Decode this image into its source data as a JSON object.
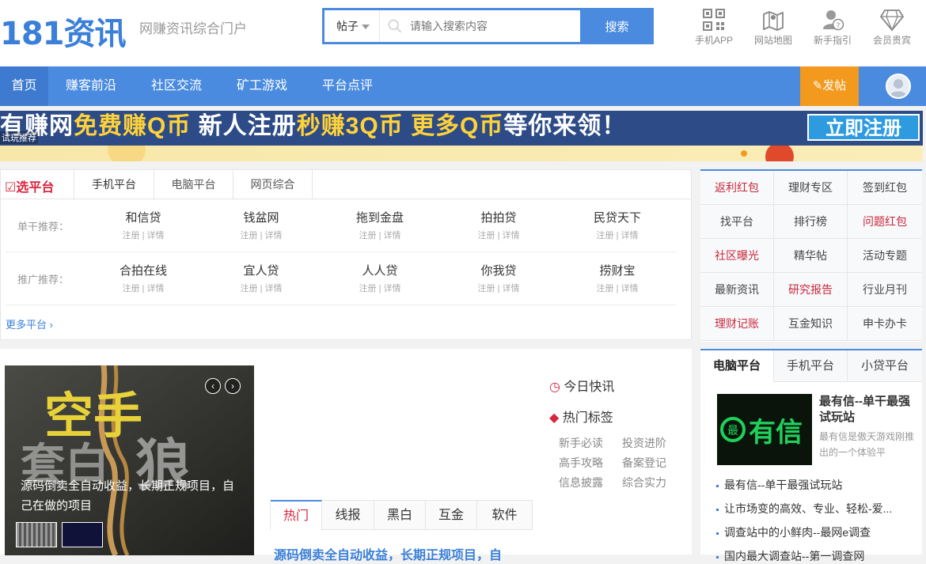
{
  "header": {
    "logo_text": "181资讯",
    "slogan": "网赚资讯综合门户",
    "search": {
      "category": "帖子",
      "placeholder": "请输入搜索内容",
      "button_label": "搜索"
    },
    "quick_links": [
      {
        "label": "手机APP",
        "icon": "qrcode-icon"
      },
      {
        "label": "网站地图",
        "icon": "map-icon"
      },
      {
        "label": "新手指引",
        "icon": "help-user-icon"
      },
      {
        "label": "会员贵宾",
        "icon": "diamond-icon"
      }
    ]
  },
  "nav": {
    "items": [
      "首页",
      "赚客前沿",
      "社区交流",
      "矿工游戏",
      "平台点评"
    ],
    "active_index": 0,
    "post_button": "发帖"
  },
  "banner": {
    "text_parts": [
      "有赚网",
      "免费赚Q币",
      "新人注册",
      "秒赚3Q币",
      "更多Q币",
      "等你来领！"
    ],
    "cta": "立即注册",
    "tag": "试玩推荐"
  },
  "platforms": {
    "title": "选平台",
    "tabs": [
      "手机平台",
      "电脑平台",
      "网页综合"
    ],
    "active_tab": 0,
    "rows": [
      {
        "label": "单干推荐：",
        "items": [
          "和信贷",
          "钱盆网",
          "拖到金盘",
          "拍拍贷",
          "民贷天下"
        ]
      },
      {
        "label": "推广推荐：",
        "items": [
          "合拍在线",
          "宜人贷",
          "人人贷",
          "你我贷",
          "捞财宝"
        ]
      }
    ],
    "sub_register": "注册",
    "sub_sep": "|",
    "sub_detail": "详情",
    "more": "更多平台 ›"
  },
  "link_grid": [
    {
      "label": "返利红包",
      "red": true
    },
    {
      "label": "理财专区",
      "red": false
    },
    {
      "label": "签到红包",
      "red": false
    },
    {
      "label": "找平台",
      "red": false
    },
    {
      "label": "排行榜",
      "red": false
    },
    {
      "label": "问题红包",
      "red": true
    },
    {
      "label": "社区曝光",
      "red": true
    },
    {
      "label": "精华帖",
      "red": false
    },
    {
      "label": "活动专题",
      "red": false
    },
    {
      "label": "最新资讯",
      "red": false
    },
    {
      "label": "研究报告",
      "red": true
    },
    {
      "label": "行业月刊",
      "red": false
    },
    {
      "label": "理财记账",
      "red": true
    },
    {
      "label": "互金知识",
      "red": false
    },
    {
      "label": "申卡办卡",
      "red": false
    }
  ],
  "slider": {
    "caption": "源码倒卖全自动收益，长期正规项目，自己在做的项目",
    "image_text": "空手套白狼",
    "prev": "‹",
    "next": "›"
  },
  "news_tabs": [
    "热门",
    "线报",
    "黑白",
    "互金",
    "软件"
  ],
  "news_active": 0,
  "headline": "源码倒卖全自动收益，长期正规项目，自",
  "today_news": "今日快讯",
  "hot_tags_title": "热门标签",
  "hot_tags": [
    "新手必读",
    "投资进阶",
    "高手攻略",
    "备案登记",
    "信息披露",
    "综合实力"
  ],
  "right_box": {
    "tabs": [
      "电脑平台",
      "手机平台",
      "小贷平台"
    ],
    "active_tab": 0,
    "image_text": "有信",
    "title": "最有信--单干最强试玩站",
    "desc": "最有信是傲天游戏刚推出的一个体验平",
    "list": [
      "最有信--单干最强试玩站",
      "让市场变的高效、专业、轻松-爱...",
      "调查站中的小鲜肉--最网e调查",
      "国内最大调查站--第一调查网"
    ]
  },
  "colors": {
    "primary": "#4a8be0",
    "accent_red": "#d7263d",
    "post_orange": "#f39a1e"
  }
}
